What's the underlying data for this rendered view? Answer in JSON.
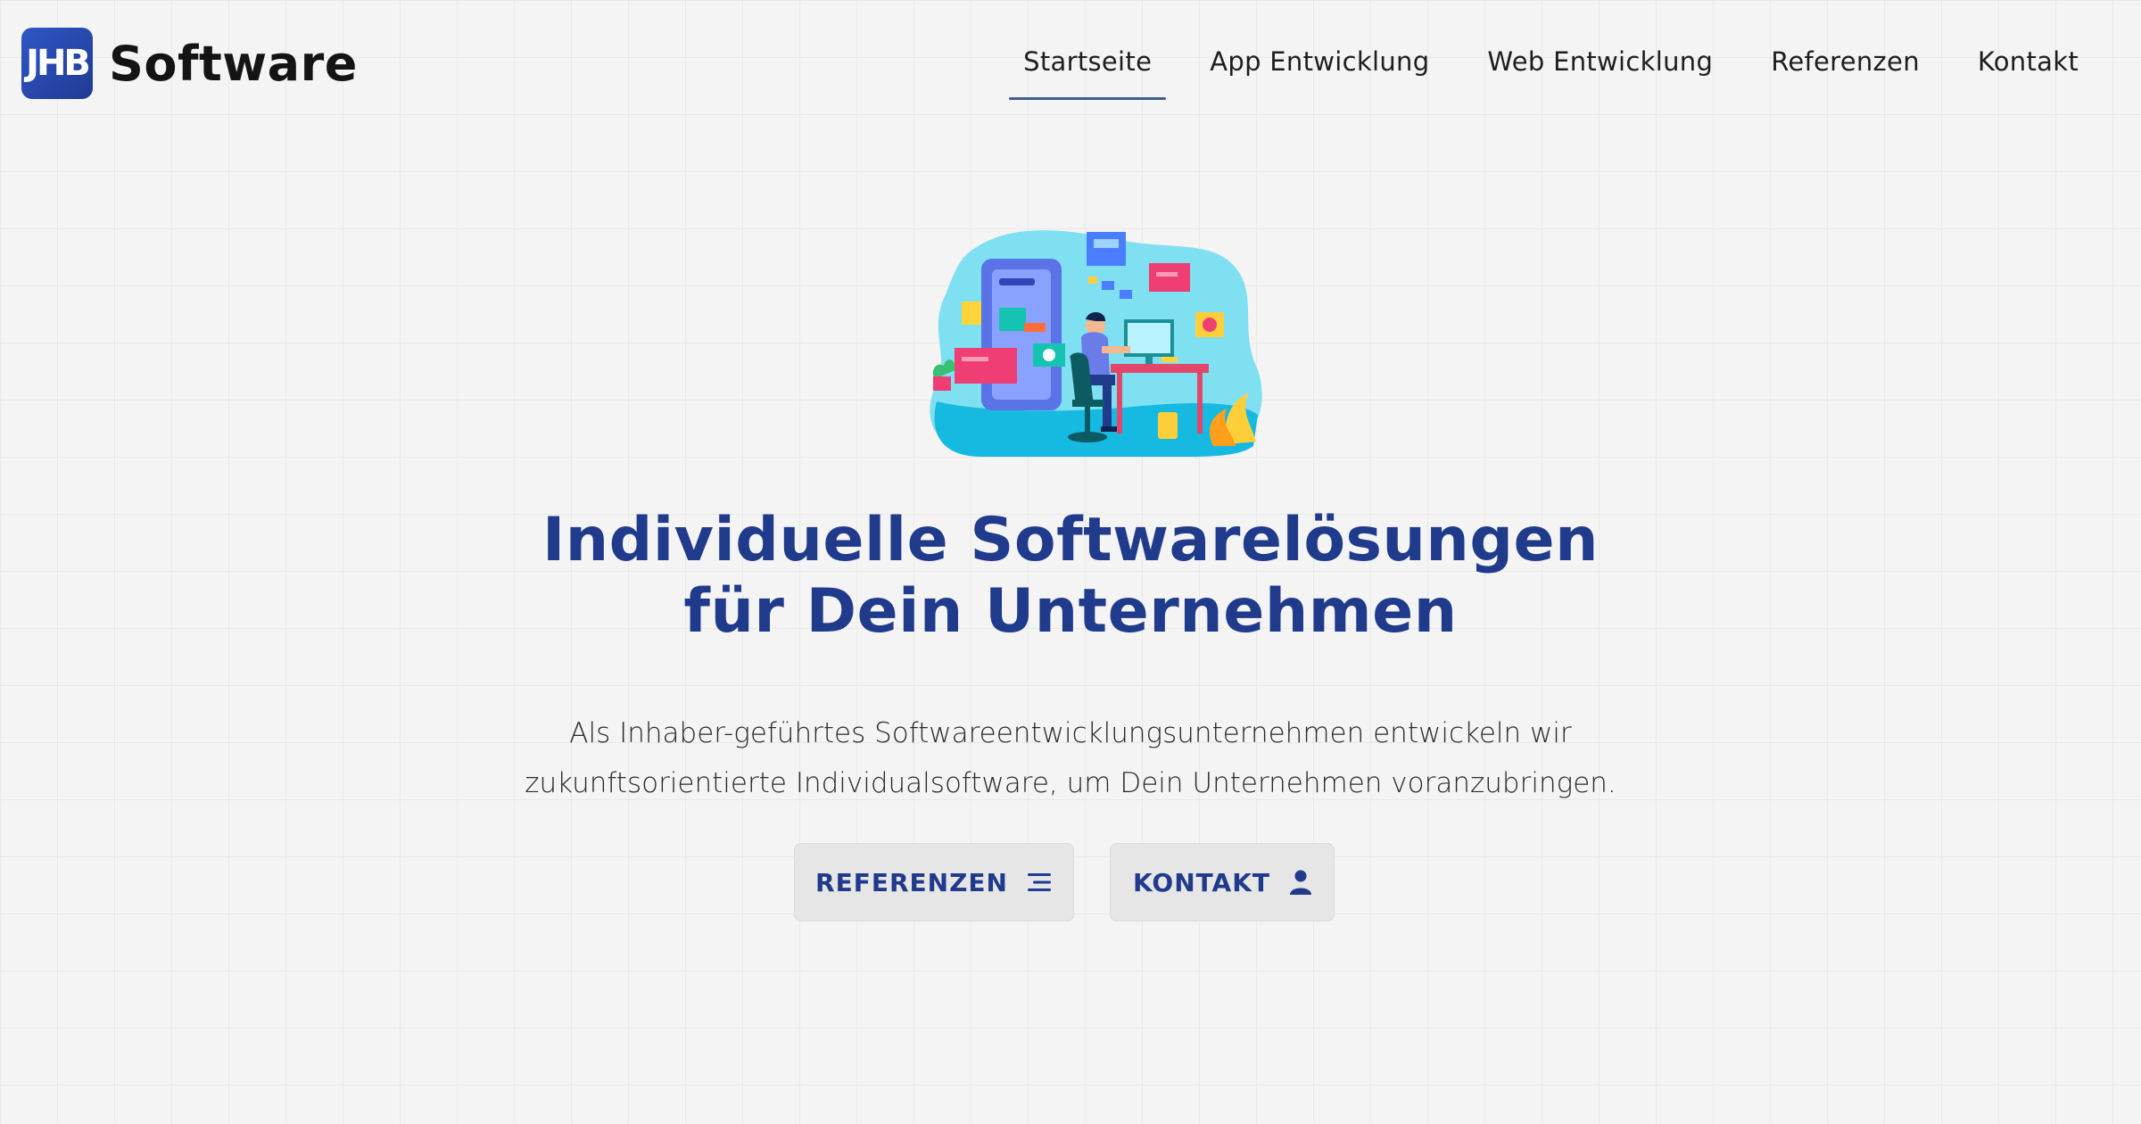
{
  "brand": {
    "logo_mark": "JHB",
    "name": "Software"
  },
  "nav": {
    "items": [
      {
        "label": "Startseite",
        "active": true
      },
      {
        "label": "App Entwicklung",
        "active": false
      },
      {
        "label": "Web Entwicklung",
        "active": false
      },
      {
        "label": "Referenzen",
        "active": false
      },
      {
        "label": "Kontakt",
        "active": false
      }
    ]
  },
  "hero": {
    "headline_line1": "Individuelle Softwarelösungen",
    "headline_line2": "für Dein Unternehmen",
    "subtitle_line1": "Als Inhaber-geführtes Softwareentwicklungsunternehmen entwickeln wir",
    "subtitle_line2": "zukunftsorientierte Individualsoftware, um Dein Unternehmen voranzubringen.",
    "illustration_icon": "developer-at-desk-illustration"
  },
  "buttons": {
    "referenzen": {
      "label": "REFERENZEN",
      "icon": "list-icon"
    },
    "kontakt": {
      "label": "KONTAKT",
      "icon": "user-icon"
    }
  },
  "colors": {
    "accent": "#203a8c",
    "logo_gradient_start": "#2f57c7",
    "logo_gradient_end": "#1f3a93",
    "nav_underline": "#3e5f8e",
    "background": "#f4f4f4",
    "button_bg": "#e6e6e6"
  }
}
